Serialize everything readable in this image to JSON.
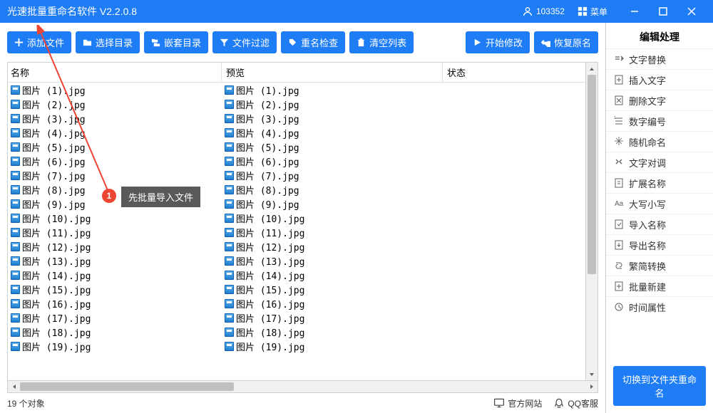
{
  "titlebar": {
    "title": "光速批量重命名软件 V2.2.0.8",
    "user_id": "103352",
    "menu_label": "菜单"
  },
  "toolbar": {
    "add_file": "添加文件",
    "select_dir": "选择目录",
    "nested_dir": "嵌套目录",
    "file_filter": "文件过滤",
    "rename_check": "重名检查",
    "clear_list": "清空列表",
    "start_modify": "开始修改",
    "restore_name": "恢复原名"
  },
  "table": {
    "col_name": "名称",
    "col_preview": "预览",
    "col_status": "状态",
    "rows": [
      {
        "name": "图片 (1).jpg",
        "preview": "图片 (1).jpg"
      },
      {
        "name": "图片 (2).jpg",
        "preview": "图片 (2).jpg"
      },
      {
        "name": "图片 (3).jpg",
        "preview": "图片 (3).jpg"
      },
      {
        "name": "图片 (4).jpg",
        "preview": "图片 (4).jpg"
      },
      {
        "name": "图片 (5).jpg",
        "preview": "图片 (5).jpg"
      },
      {
        "name": "图片 (6).jpg",
        "preview": "图片 (6).jpg"
      },
      {
        "name": "图片 (7).jpg",
        "preview": "图片 (7).jpg"
      },
      {
        "name": "图片 (8).jpg",
        "preview": "图片 (8).jpg"
      },
      {
        "name": "图片 (9).jpg",
        "preview": "图片 (9).jpg"
      },
      {
        "name": "图片 (10).jpg",
        "preview": "图片 (10).jpg"
      },
      {
        "name": "图片 (11).jpg",
        "preview": "图片 (11).jpg"
      },
      {
        "name": "图片 (12).jpg",
        "preview": "图片 (12).jpg"
      },
      {
        "name": "图片 (13).jpg",
        "preview": "图片 (13).jpg"
      },
      {
        "name": "图片 (14).jpg",
        "preview": "图片 (14).jpg"
      },
      {
        "name": "图片 (15).jpg",
        "preview": "图片 (15).jpg"
      },
      {
        "name": "图片 (16).jpg",
        "preview": "图片 (16).jpg"
      },
      {
        "name": "图片 (17).jpg",
        "preview": "图片 (17).jpg"
      },
      {
        "name": "图片 (18).jpg",
        "preview": "图片 (18).jpg"
      },
      {
        "name": "图片 (19).jpg",
        "preview": "图片 (19).jpg"
      }
    ]
  },
  "statusbar": {
    "object_count": "19 个对象",
    "official_site": "官方网站",
    "qq_service": "QQ客服"
  },
  "right": {
    "title": "编辑处理",
    "items": [
      "文字替换",
      "插入文字",
      "删除文字",
      "数字编号",
      "随机命名",
      "文字对调",
      "扩展名称",
      "大写小写",
      "导入名称",
      "导出名称",
      "繁简转换",
      "批量新建",
      "时间属性"
    ],
    "switch_btn": "切换到文件夹重命名"
  },
  "annotation": {
    "badge": "1",
    "tip": "先批量导入文件"
  }
}
